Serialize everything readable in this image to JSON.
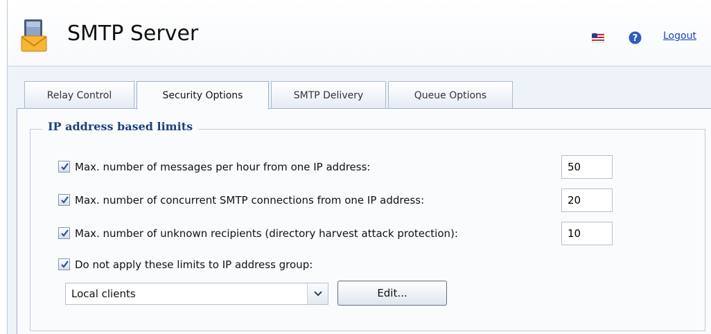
{
  "header": {
    "title": "SMTP Server",
    "app_icon": "mail-server-icon",
    "language_icon": "us-flag-icon",
    "help_icon": "help-icon",
    "logout_label": "Logout"
  },
  "tabs": [
    {
      "label": "Relay Control",
      "active": false
    },
    {
      "label": "Security Options",
      "active": true
    },
    {
      "label": "SMTP Delivery",
      "active": false
    },
    {
      "label": "Queue Options",
      "active": false
    }
  ],
  "section": {
    "legend": "IP address based limits",
    "rows": [
      {
        "label": "Max. number of messages per hour from one IP address:",
        "checked": true,
        "value": "50"
      },
      {
        "label": "Max. number of concurrent SMTP connections from one IP address:",
        "checked": true,
        "value": "20"
      },
      {
        "label": "Max. number of unknown recipients (directory harvest attack protection):",
        "checked": true,
        "value": "10"
      },
      {
        "label": "Do not apply these limits to IP address group:",
        "checked": true
      }
    ],
    "group_select": {
      "value": "Local clients"
    },
    "edit_label": "Edit..."
  },
  "colors": {
    "legend": "#1e3f7c",
    "link": "#1a3cc8",
    "checkmark": "#2c4f9a",
    "help": "#2e5fb8"
  }
}
